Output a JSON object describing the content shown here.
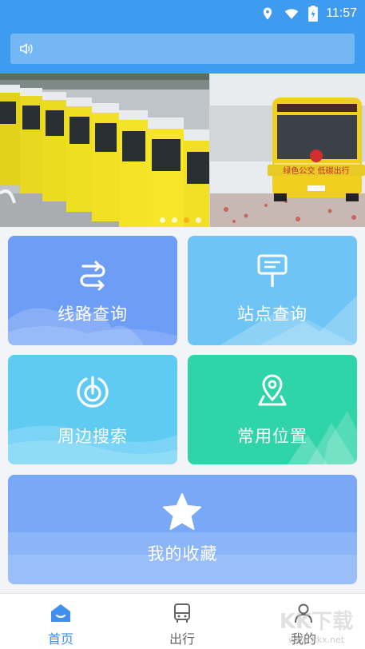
{
  "status_bar": {
    "time": "11:57",
    "icons": [
      "location-icon",
      "wifi-icon",
      "battery-charging-icon"
    ]
  },
  "notice": {
    "icon": "speaker-icon",
    "text": ""
  },
  "banner": {
    "slides": 4,
    "active_slide": 3,
    "slide2_sign_text": "绿色公交 低碳出行"
  },
  "tiles": [
    {
      "label": "线路查询",
      "icon": "route-icon",
      "color": "#6e9df6"
    },
    {
      "label": "站点查询",
      "icon": "bus-stop-icon",
      "color": "#6ec5f5"
    },
    {
      "label": "周边搜索",
      "icon": "nearby-radar-icon",
      "color": "#5fcbf3"
    },
    {
      "label": "常用位置",
      "icon": "map-pin-icon",
      "color": "#2fd4a8"
    },
    {
      "label": "我的收藏",
      "icon": "star-icon",
      "color": "#79a9f6"
    }
  ],
  "nav": [
    {
      "label": "首页",
      "icon": "home-icon",
      "active": true
    },
    {
      "label": "出行",
      "icon": "bus-icon",
      "active": false
    },
    {
      "label": "我的",
      "icon": "user-icon",
      "active": false
    }
  ],
  "watermark": {
    "text": "KK下载",
    "url_text": "www.kkx.net"
  },
  "colors": {
    "primary": "#3f9bf0",
    "nav_active": "#3f8ef0",
    "dot_active": "#f5b21b"
  }
}
